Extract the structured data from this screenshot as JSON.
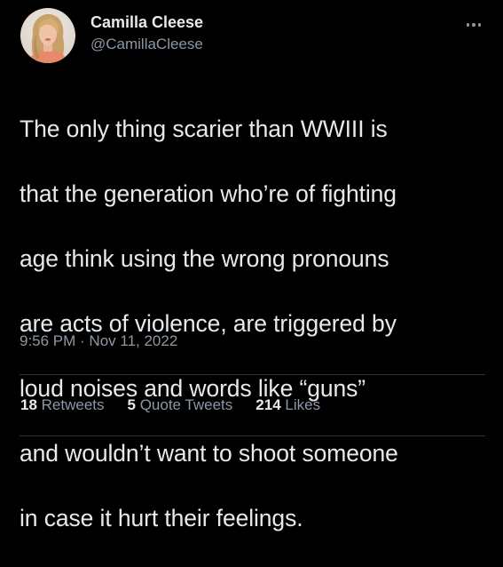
{
  "author": {
    "display_name": "Camilla Cleese",
    "handle": "@CamillaCleese",
    "avatar_icon": "profile-photo"
  },
  "more_icon": "more-horizontal-icon",
  "tweet": {
    "text_lines": [
      "The only thing scarier than WWIII is",
      "that the generation who’re of fighting",
      "age think using the wrong pronouns",
      "are acts of violence, are triggered by",
      "loud noises and words like “guns”",
      "and wouldn’t want to shoot someone",
      "in case it hurt their feelings."
    ],
    "timestamp": "9:56 PM · Nov 11, 2022"
  },
  "stats": {
    "retweets": {
      "count": "18",
      "label": "Retweets"
    },
    "quote_tweets": {
      "count": "5",
      "label": "Quote Tweets"
    },
    "likes": {
      "count": "214",
      "label": "Likes"
    }
  },
  "colors": {
    "background": "#000000",
    "primary_text": "#e7e9ea",
    "secondary_text": "#8b98a5",
    "divider": "#2f3336"
  }
}
